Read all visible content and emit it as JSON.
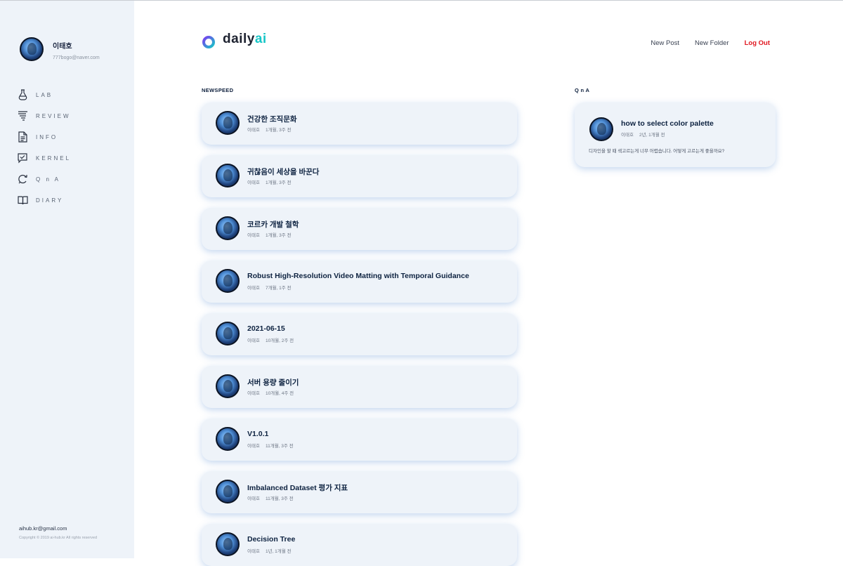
{
  "user": {
    "name": "이태호",
    "email": "777bogo@naver.com"
  },
  "sidebar": {
    "items": [
      {
        "label": "LAB",
        "icon": "flask-icon"
      },
      {
        "label": "REVIEW",
        "icon": "filter-lines-icon"
      },
      {
        "label": "INFO",
        "icon": "document-icon"
      },
      {
        "label": "KERNEL",
        "icon": "check-chat-icon"
      },
      {
        "label": "Q n A",
        "icon": "refresh-chat-icon"
      },
      {
        "label": "DIARY",
        "icon": "book-icon"
      }
    ],
    "footer": {
      "email": "aihub.kr@gmail.com",
      "copyright": "Copyright © 2019 ai-hub.kr All rights reserved"
    }
  },
  "brand": {
    "prefix": "daily",
    "suffix": "ai",
    "accent": "#17c6c7"
  },
  "topnav": {
    "new_post": "New Post",
    "new_folder": "New Folder",
    "logout": "Log Out",
    "logout_color": "#e0161f"
  },
  "newsfeed": {
    "title": "NEWSPEED",
    "posts": [
      {
        "title": "건강한 조직문화",
        "author": "이태호",
        "ago": "1개월, 3주 전"
      },
      {
        "title": "귀찮음이 세상을 바꾼다",
        "author": "이태호",
        "ago": "1개월, 3주 전"
      },
      {
        "title": "코르카 개발 철학",
        "author": "이태호",
        "ago": "1개월, 3주 전"
      },
      {
        "title": "Robust High-Resolution Video Matting with Temporal Guidance",
        "author": "이태호",
        "ago": "7개월, 1주 전"
      },
      {
        "title": "2021-06-15",
        "author": "이태호",
        "ago": "10개월, 2주 전"
      },
      {
        "title": "서버 용량 줄이기",
        "author": "이태호",
        "ago": "10개월, 4주 전"
      },
      {
        "title": "V1.0.1",
        "author": "이태호",
        "ago": "11개월, 3주 전"
      },
      {
        "title": "Imbalanced Dataset 평가 지표",
        "author": "이태호",
        "ago": "11개월, 3주 전"
      },
      {
        "title": "Decision Tree",
        "author": "이태호",
        "ago": "1년, 1개월 전"
      }
    ]
  },
  "qna": {
    "title": "Q n A",
    "posts": [
      {
        "title": "how to select color palette",
        "author": "이태호",
        "ago": "2년, 1개월 전",
        "body": "디자인을 할 때 색고르는게 너무 어렵습니다. 어떻게 고르는게 좋을까요?"
      }
    ]
  }
}
